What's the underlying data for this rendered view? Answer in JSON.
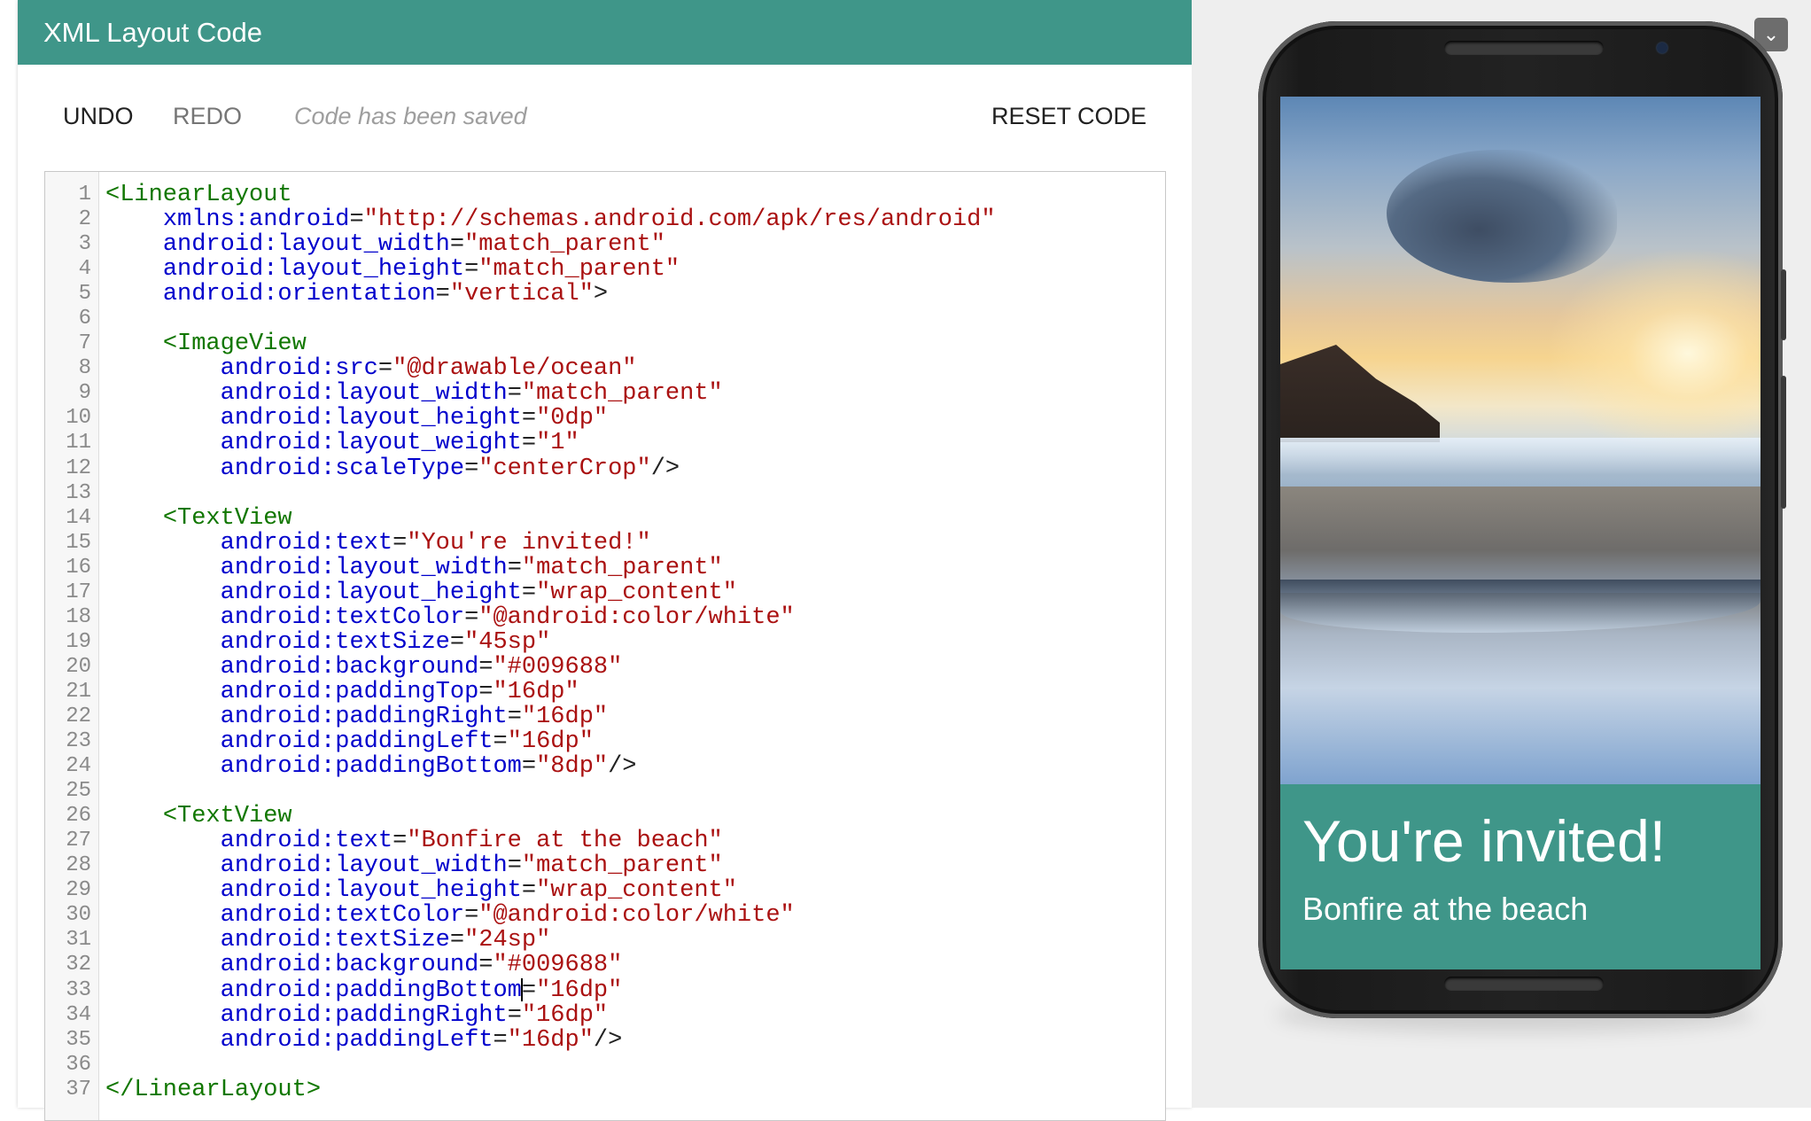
{
  "panel": {
    "title": "XML Layout Code"
  },
  "toolbar": {
    "undo": "UNDO",
    "redo": "REDO",
    "status": "Code has been saved",
    "reset": "RESET CODE"
  },
  "editor": {
    "lines": [
      [
        [
          "tag",
          "<LinearLayout"
        ]
      ],
      [
        [
          "plain",
          "    "
        ],
        [
          "attr",
          "xmlns:android"
        ],
        [
          "punc",
          "="
        ],
        [
          "str",
          "\"http://schemas.android.com/apk/res/android\""
        ]
      ],
      [
        [
          "plain",
          "    "
        ],
        [
          "attr",
          "android:layout_width"
        ],
        [
          "punc",
          "="
        ],
        [
          "str",
          "\"match_parent\""
        ]
      ],
      [
        [
          "plain",
          "    "
        ],
        [
          "attr",
          "android:layout_height"
        ],
        [
          "punc",
          "="
        ],
        [
          "str",
          "\"match_parent\""
        ]
      ],
      [
        [
          "plain",
          "    "
        ],
        [
          "attr",
          "android:orientation"
        ],
        [
          "punc",
          "="
        ],
        [
          "str",
          "\"vertical\""
        ],
        [
          "punc",
          ">"
        ]
      ],
      [],
      [
        [
          "plain",
          "    "
        ],
        [
          "tag",
          "<ImageView"
        ]
      ],
      [
        [
          "plain",
          "        "
        ],
        [
          "attr",
          "android:src"
        ],
        [
          "punc",
          "="
        ],
        [
          "str",
          "\"@drawable/ocean\""
        ]
      ],
      [
        [
          "plain",
          "        "
        ],
        [
          "attr",
          "android:layout_width"
        ],
        [
          "punc",
          "="
        ],
        [
          "str",
          "\"match_parent\""
        ]
      ],
      [
        [
          "plain",
          "        "
        ],
        [
          "attr",
          "android:layout_height"
        ],
        [
          "punc",
          "="
        ],
        [
          "str",
          "\"0dp\""
        ]
      ],
      [
        [
          "plain",
          "        "
        ],
        [
          "attr",
          "android:layout_weight"
        ],
        [
          "punc",
          "="
        ],
        [
          "str",
          "\"1\""
        ]
      ],
      [
        [
          "plain",
          "        "
        ],
        [
          "attr",
          "android:scaleType"
        ],
        [
          "punc",
          "="
        ],
        [
          "str",
          "\"centerCrop\""
        ],
        [
          "punc",
          "/>"
        ]
      ],
      [],
      [
        [
          "plain",
          "    "
        ],
        [
          "tag",
          "<TextView"
        ]
      ],
      [
        [
          "plain",
          "        "
        ],
        [
          "attr",
          "android:text"
        ],
        [
          "punc",
          "="
        ],
        [
          "str",
          "\"You're invited!\""
        ]
      ],
      [
        [
          "plain",
          "        "
        ],
        [
          "attr",
          "android:layout_width"
        ],
        [
          "punc",
          "="
        ],
        [
          "str",
          "\"match_parent\""
        ]
      ],
      [
        [
          "plain",
          "        "
        ],
        [
          "attr",
          "android:layout_height"
        ],
        [
          "punc",
          "="
        ],
        [
          "str",
          "\"wrap_content\""
        ]
      ],
      [
        [
          "plain",
          "        "
        ],
        [
          "attr",
          "android:textColor"
        ],
        [
          "punc",
          "="
        ],
        [
          "str",
          "\"@android:color/white\""
        ]
      ],
      [
        [
          "plain",
          "        "
        ],
        [
          "attr",
          "android:textSize"
        ],
        [
          "punc",
          "="
        ],
        [
          "str",
          "\"45sp\""
        ]
      ],
      [
        [
          "plain",
          "        "
        ],
        [
          "attr",
          "android:background"
        ],
        [
          "punc",
          "="
        ],
        [
          "str",
          "\"#009688\""
        ]
      ],
      [
        [
          "plain",
          "        "
        ],
        [
          "attr",
          "android:paddingTop"
        ],
        [
          "punc",
          "="
        ],
        [
          "str",
          "\"16dp\""
        ]
      ],
      [
        [
          "plain",
          "        "
        ],
        [
          "attr",
          "android:paddingRight"
        ],
        [
          "punc",
          "="
        ],
        [
          "str",
          "\"16dp\""
        ]
      ],
      [
        [
          "plain",
          "        "
        ],
        [
          "attr",
          "android:paddingLeft"
        ],
        [
          "punc",
          "="
        ],
        [
          "str",
          "\"16dp\""
        ]
      ],
      [
        [
          "plain",
          "        "
        ],
        [
          "attr",
          "android:paddingBottom"
        ],
        [
          "punc",
          "="
        ],
        [
          "str",
          "\"8dp\""
        ],
        [
          "punc",
          "/>"
        ]
      ],
      [],
      [
        [
          "plain",
          "    "
        ],
        [
          "tag",
          "<TextView"
        ]
      ],
      [
        [
          "plain",
          "        "
        ],
        [
          "attr",
          "android:text"
        ],
        [
          "punc",
          "="
        ],
        [
          "str",
          "\"Bonfire at the beach\""
        ]
      ],
      [
        [
          "plain",
          "        "
        ],
        [
          "attr",
          "android:layout_width"
        ],
        [
          "punc",
          "="
        ],
        [
          "str",
          "\"match_parent\""
        ]
      ],
      [
        [
          "plain",
          "        "
        ],
        [
          "attr",
          "android:layout_height"
        ],
        [
          "punc",
          "="
        ],
        [
          "str",
          "\"wrap_content\""
        ]
      ],
      [
        [
          "plain",
          "        "
        ],
        [
          "attr",
          "android:textColor"
        ],
        [
          "punc",
          "="
        ],
        [
          "str",
          "\"@android:color/white\""
        ]
      ],
      [
        [
          "plain",
          "        "
        ],
        [
          "attr",
          "android:textSize"
        ],
        [
          "punc",
          "="
        ],
        [
          "str",
          "\"24sp\""
        ]
      ],
      [
        [
          "plain",
          "        "
        ],
        [
          "attr",
          "android:background"
        ],
        [
          "punc",
          "="
        ],
        [
          "str",
          "\"#009688\""
        ]
      ],
      [
        [
          "plain",
          "        "
        ],
        [
          "attr",
          "android:paddingBottom"
        ],
        [
          "cursor",
          ""
        ],
        [
          "punc",
          "="
        ],
        [
          "str",
          "\"16dp\""
        ]
      ],
      [
        [
          "plain",
          "        "
        ],
        [
          "attr",
          "android:paddingRight"
        ],
        [
          "punc",
          "="
        ],
        [
          "str",
          "\"16dp\""
        ]
      ],
      [
        [
          "plain",
          "        "
        ],
        [
          "attr",
          "android:paddingLeft"
        ],
        [
          "punc",
          "="
        ],
        [
          "str",
          "\"16dp\""
        ],
        [
          "punc",
          "/>"
        ]
      ],
      [],
      [
        [
          "tag",
          "</LinearLayout>"
        ]
      ]
    ]
  },
  "preview": {
    "title": "You're invited!",
    "subtitle": "Bonfire at the beach",
    "banner_color": "#3f9689",
    "collapse_icon": "chevron-down-icon"
  },
  "colors": {
    "accent": "#3f9689",
    "tag": "#117700",
    "attr": "#0000cc",
    "string": "#aa1111"
  }
}
